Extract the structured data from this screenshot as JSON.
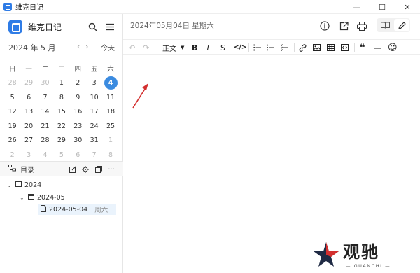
{
  "window": {
    "title": "维克日记",
    "controls": {
      "minimize": "—",
      "maximize": "☐",
      "close": "✕"
    }
  },
  "sidebar": {
    "brand": "维克日记",
    "icons": [
      "search-icon",
      "menu-icon"
    ],
    "calendar": {
      "month_label": "2024 年 5 月",
      "prev": "‹",
      "next": "›",
      "today_label": "今天",
      "weekdays": [
        "日",
        "一",
        "二",
        "三",
        "四",
        "五",
        "六"
      ],
      "weeks": [
        [
          {
            "d": "28",
            "m": true
          },
          {
            "d": "29",
            "m": true
          },
          {
            "d": "30",
            "m": true
          },
          {
            "d": "1"
          },
          {
            "d": "2"
          },
          {
            "d": "3"
          },
          {
            "d": "4",
            "sel": true
          }
        ],
        [
          {
            "d": "5"
          },
          {
            "d": "6"
          },
          {
            "d": "7"
          },
          {
            "d": "8"
          },
          {
            "d": "9"
          },
          {
            "d": "10"
          },
          {
            "d": "11"
          }
        ],
        [
          {
            "d": "12"
          },
          {
            "d": "13"
          },
          {
            "d": "14"
          },
          {
            "d": "15"
          },
          {
            "d": "16"
          },
          {
            "d": "17"
          },
          {
            "d": "18"
          }
        ],
        [
          {
            "d": "19"
          },
          {
            "d": "20"
          },
          {
            "d": "21"
          },
          {
            "d": "22"
          },
          {
            "d": "23"
          },
          {
            "d": "24"
          },
          {
            "d": "25"
          }
        ],
        [
          {
            "d": "26"
          },
          {
            "d": "27"
          },
          {
            "d": "28"
          },
          {
            "d": "29"
          },
          {
            "d": "30"
          },
          {
            "d": "31"
          },
          {
            "d": "1",
            "m": true
          }
        ],
        [
          {
            "d": "2",
            "m": true
          },
          {
            "d": "3",
            "m": true
          },
          {
            "d": "4",
            "m": true
          },
          {
            "d": "5",
            "m": true
          },
          {
            "d": "6",
            "m": true
          },
          {
            "d": "7",
            "m": true
          },
          {
            "d": "8",
            "m": true
          }
        ]
      ]
    },
    "directory": {
      "label": "目录",
      "actions": [
        "edit-icon",
        "locate-icon",
        "collapse-icon",
        "more-icon"
      ],
      "more_label": "···",
      "tree": [
        {
          "label": "2024",
          "level": 0
        },
        {
          "label": "2024-05",
          "level": 1
        },
        {
          "label": "2024-05-04",
          "day": "周六",
          "level": 2
        }
      ]
    }
  },
  "main": {
    "date_title": "2024年05月04日 星期六",
    "header_icons": [
      "info-icon",
      "export-icon",
      "print-icon"
    ],
    "modes": [
      "read-mode-icon",
      "edit-mode-icon"
    ],
    "toolbar": {
      "undo": "↶",
      "redo": "↷",
      "heading": "正文",
      "bold": "B",
      "italic": "I",
      "strike": "S",
      "code": "</>",
      "quote": "❝",
      "hr": "—",
      "emoji": "☺"
    }
  },
  "watermark": {
    "text": "观驰",
    "sub": "— GUANCHI —"
  },
  "colors": {
    "accent": "#3b8be0",
    "brand": "#2f7ce6",
    "arrow": "#d32f2f"
  }
}
